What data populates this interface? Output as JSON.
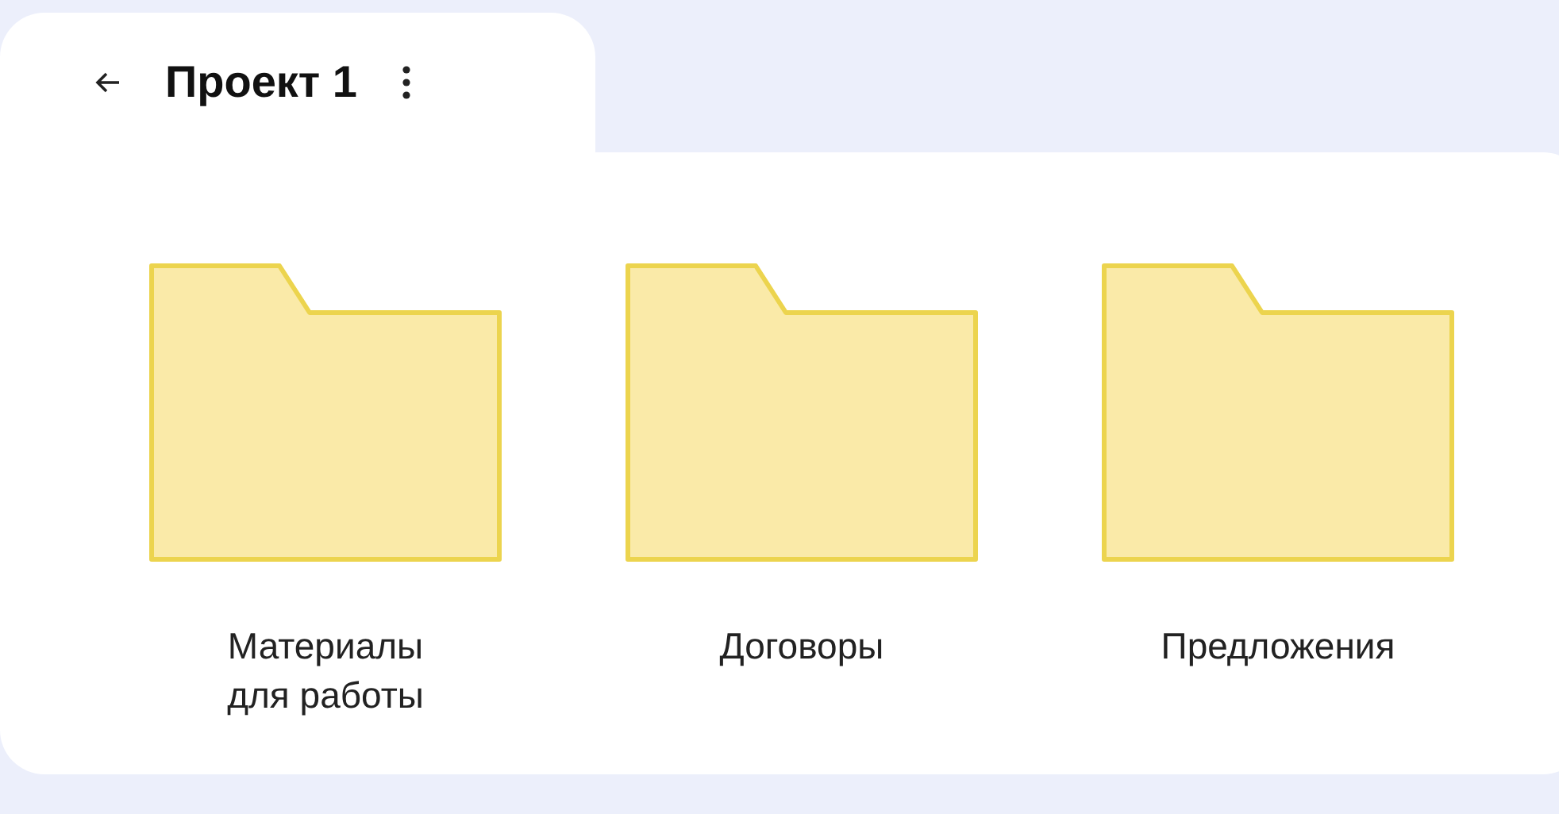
{
  "header": {
    "title": "Проект 1"
  },
  "folders": [
    {
      "name": "Материалы\nдля работы"
    },
    {
      "name": "Договоры"
    },
    {
      "name": "Предложения"
    }
  ]
}
